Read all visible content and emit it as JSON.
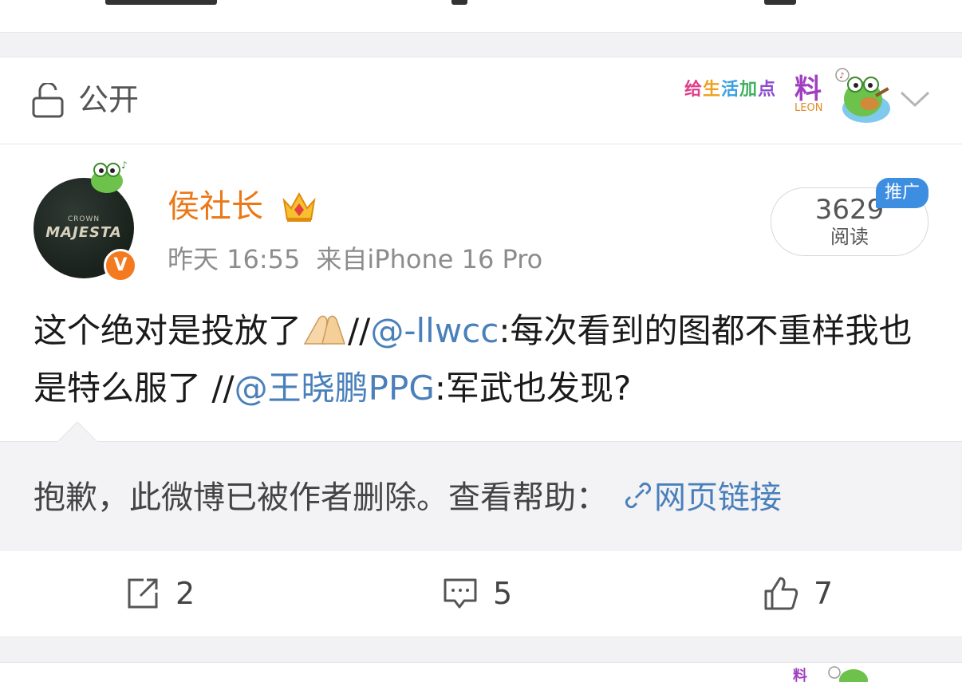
{
  "visibility": {
    "label": "公开"
  },
  "sticker": {
    "text_chars": [
      "给",
      "生",
      "活",
      "加",
      "点"
    ],
    "big": "料",
    "sub": "LEON"
  },
  "post": {
    "username": "侯社长",
    "avatar": {
      "crown_text": "CROWN",
      "brand_text": "MAJESTA",
      "verified_mark": "V"
    },
    "time": "昨天 16:55",
    "source": "来自iPhone 16 Pro",
    "reads": {
      "count": "3629",
      "label": "阅读"
    },
    "promo_badge": "推广",
    "text": {
      "part1": "这个绝对是投放了",
      "sep1": "//",
      "mention1": "@-llwcc",
      "part2": ":每次看到的图都不重样我也是特么服了 ",
      "sep2": "//",
      "mention2": "@王晓鹏PPG",
      "part3": ":军武也发现?"
    },
    "repost": {
      "deleted_message": "抱歉，此微博已被作者删除。查看帮助：",
      "link_label": "网页链接"
    },
    "actions": {
      "repost_count": "2",
      "comment_count": "5",
      "like_count": "7"
    }
  },
  "colors": {
    "username": "#eb7817",
    "link": "#4a80ba",
    "verified": "#f47a1f",
    "promo": "#3d8ee0"
  }
}
